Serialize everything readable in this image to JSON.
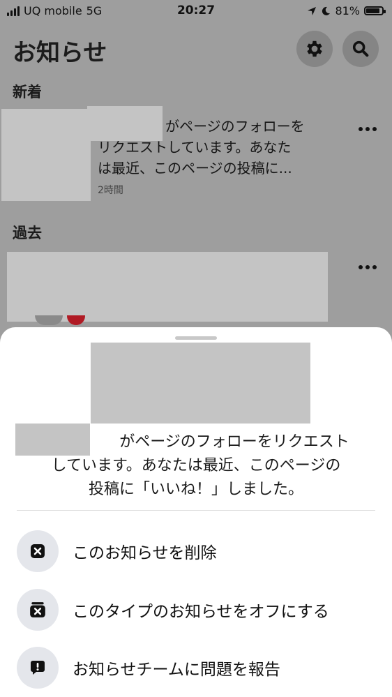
{
  "status_bar": {
    "carrier": "UQ mobile",
    "network": "5G",
    "time": "20:27",
    "battery": "81%"
  },
  "header": {
    "title": "お知らせ",
    "settings_icon": "gear-icon",
    "search_icon": "search-icon"
  },
  "sections": {
    "new": "新着",
    "past": "過去"
  },
  "notification": {
    "lines": [
      "がページのフォローを",
      "リクエストしています。あなた",
      "は最近、このページの投稿に..."
    ],
    "time": "2時間"
  },
  "sheet": {
    "message_lines": [
      "がページのフォローをリクエスト",
      "しています。あなたは最近、このページの",
      "投稿に「いいね！」しました。"
    ],
    "actions": [
      {
        "label": "このお知らせを削除",
        "icon": "close-box-icon"
      },
      {
        "label": "このタイプのお知らせをオフにする",
        "icon": "notification-off-icon"
      },
      {
        "label": "お知らせチームに問題を報告",
        "icon": "report-icon"
      }
    ]
  },
  "colors": {
    "overlay_background": "#9e9e9e",
    "sheet_background": "#ffffff",
    "action_icon_background": "#e4e6eb",
    "redaction": "#c4c4c4"
  }
}
